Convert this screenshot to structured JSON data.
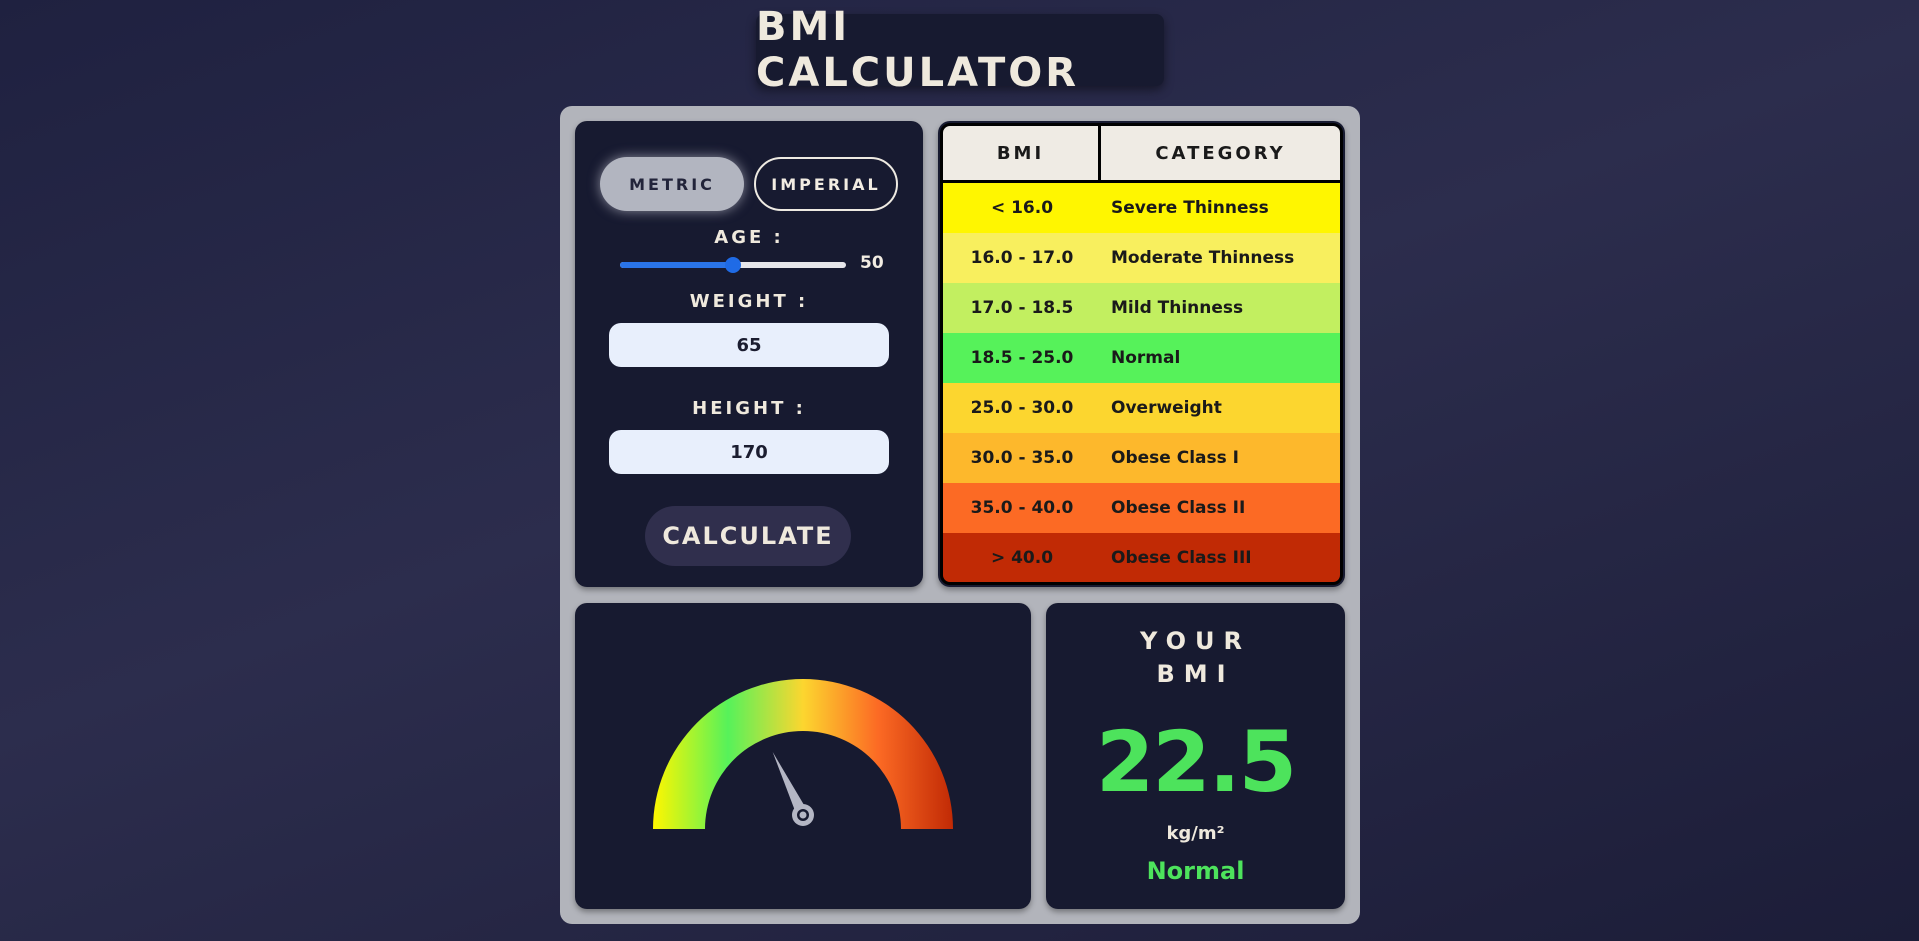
{
  "app": {
    "title": "BMI CALCULATOR"
  },
  "units": {
    "metric_label": "METRIC",
    "imperial_label": "IMPERIAL",
    "selected": "metric"
  },
  "age": {
    "label": "AGE :",
    "value": "50",
    "min": 0,
    "max": 100
  },
  "weight": {
    "label": "WEIGHT :",
    "value": "65"
  },
  "height": {
    "label": "HEIGHT :",
    "value": "170"
  },
  "calculate_label": "CALCULATE",
  "table": {
    "headers": {
      "bmi": "BMI",
      "category": "CATEGORY"
    },
    "rows": [
      {
        "range": "< 16.0",
        "category": "Severe Thinness",
        "color": "#fff600"
      },
      {
        "range": "16.0 - 17.0",
        "category": "Moderate Thinness",
        "color": "#f8ef5e"
      },
      {
        "range": "17.0 - 18.5",
        "category": "Mild Thinness",
        "color": "#c2ef60"
      },
      {
        "range": "18.5 - 25.0",
        "category": "Normal",
        "color": "#56f25a"
      },
      {
        "range": "25.0 - 30.0",
        "category": "Overweight",
        "color": "#fcd62f"
      },
      {
        "range": "30.0 - 35.0",
        "category": "Obese Class I",
        "color": "#fdb82c"
      },
      {
        "range": "35.0 - 40.0",
        "category": "Obese Class II",
        "color": "#fc6a24"
      },
      {
        "range": "> 40.0",
        "category": "Obese Class III",
        "color": "#c12a05"
      }
    ]
  },
  "gauge": {
    "value": 22.5,
    "min": 10,
    "max": 45,
    "gradient": [
      "#fff600",
      "#56f25a",
      "#fcd62f",
      "#fc6a24",
      "#c12a05"
    ]
  },
  "result": {
    "heading_line1": "YOUR",
    "heading_line2": "BMI",
    "value": "22.5",
    "unit": "kg/m²",
    "category": "Normal",
    "color": "#4de35c"
  }
}
